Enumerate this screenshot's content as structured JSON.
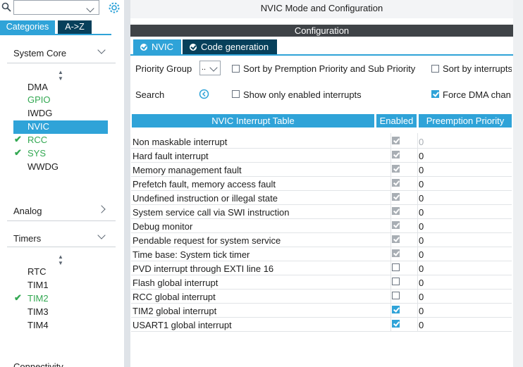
{
  "sidebar": {
    "search_value": "",
    "tabs": [
      {
        "label": "Categories"
      },
      {
        "label": "A->Z"
      }
    ],
    "system_core": {
      "title": "System Core",
      "items": [
        {
          "label": "DMA"
        },
        {
          "label": "GPIO"
        },
        {
          "label": "IWDG"
        },
        {
          "label": "NVIC"
        },
        {
          "label": "RCC"
        },
        {
          "label": "SYS"
        },
        {
          "label": "WWDG"
        }
      ]
    },
    "analog": {
      "title": "Analog"
    },
    "timers": {
      "title": "Timers",
      "items": [
        {
          "label": "RTC"
        },
        {
          "label": "TIM1"
        },
        {
          "label": "TIM2"
        },
        {
          "label": "TIM3"
        },
        {
          "label": "TIM4"
        }
      ]
    },
    "connectivity": {
      "title": "Connectivity"
    }
  },
  "header": {
    "title": "NVIC Mode and Configuration"
  },
  "config": {
    "title": "Configuration",
    "tabs": [
      {
        "label": "NVIC"
      },
      {
        "label": "Code generation"
      }
    ],
    "priority_group_label": "Priority Group",
    "priority_group_value": "..",
    "sort_preemption_label": "Sort by Premption Priority and Sub Priority",
    "sort_interrupts_label": "Sort by interrupts",
    "search_label": "Search",
    "show_enabled_label": "Show only enabled interrupts",
    "force_dma_label": "Force DMA chan"
  },
  "table": {
    "headers": {
      "name": "NVIC Interrupt Table",
      "enabled": "Enabled",
      "preemption": "Preemption Priority"
    },
    "rows": [
      {
        "name": "Non maskable interrupt",
        "enabled": true,
        "locked": true,
        "priority": "0"
      },
      {
        "name": "Hard fault interrupt",
        "enabled": true,
        "locked": true,
        "priority": "0"
      },
      {
        "name": "Memory management fault",
        "enabled": true,
        "locked": true,
        "priority": "0"
      },
      {
        "name": "Prefetch fault, memory access fault",
        "enabled": true,
        "locked": true,
        "priority": "0"
      },
      {
        "name": "Undefined instruction or illegal state",
        "enabled": true,
        "locked": true,
        "priority": "0"
      },
      {
        "name": "System service call via SWI instruction",
        "enabled": true,
        "locked": true,
        "priority": "0"
      },
      {
        "name": "Debug monitor",
        "enabled": true,
        "locked": true,
        "priority": "0"
      },
      {
        "name": "Pendable request for system service",
        "enabled": true,
        "locked": true,
        "priority": "0"
      },
      {
        "name": "Time base: System tick timer",
        "enabled": true,
        "locked": true,
        "priority": "0"
      },
      {
        "name": "PVD interrupt through EXTI line 16",
        "enabled": false,
        "locked": false,
        "priority": "0"
      },
      {
        "name": "Flash global interrupt",
        "enabled": false,
        "locked": false,
        "priority": "0"
      },
      {
        "name": "RCC global interrupt",
        "enabled": false,
        "locked": false,
        "priority": "0"
      },
      {
        "name": "TIM2 global interrupt",
        "enabled": true,
        "locked": false,
        "priority": "0"
      },
      {
        "name": "USART1 global interrupt",
        "enabled": true,
        "locked": false,
        "priority": "0"
      }
    ]
  },
  "colors": {
    "accent": "#2fa3d8",
    "dark_tab": "#07405b",
    "green": "#33a852"
  }
}
